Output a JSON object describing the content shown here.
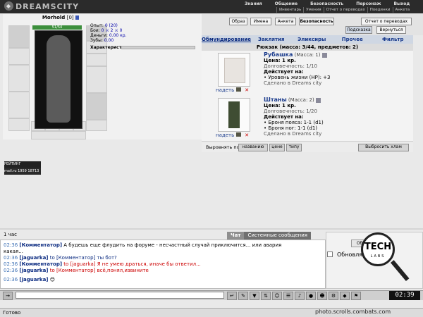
{
  "header": {
    "logo_text": "DREAMSCITY",
    "menu": [
      "Знания",
      "Общение",
      "Безопасность",
      "Персонаж",
      "Выход"
    ],
    "submenu": [
      "Инвентарь",
      "Умения",
      "Отчет о переводах",
      "Поединки",
      "Анкета"
    ]
  },
  "character": {
    "name": "Morhold",
    "level": "[0]",
    "hp": "51/54",
    "stats": [
      {
        "label": "Опыт:",
        "value": "0 (20)"
      },
      {
        "label": "Бои:",
        "value": "0 ⚔ 2 ⚔ 0"
      },
      {
        "label": "Деньги:",
        "value": "0.00 кр."
      },
      {
        "label": "Зубы:",
        "value": "0.00"
      }
    ],
    "traits_label": "Характеристики:"
  },
  "top_buttons": {
    "obraz": "Образ",
    "imena": "Имена",
    "anketa": "Анкета",
    "security": "Безопасность",
    "report": "Отчет о переводах",
    "hint": "Подсказка",
    "back": "Вернуться"
  },
  "tabs": [
    "Обмундирование",
    "Заклятия",
    "Эликсиры",
    "Прочее",
    "Фильтр"
  ],
  "backpack_label": "Рюкзак (масса: 3/44, предметов: 2)",
  "items": [
    {
      "name": "Рубашка",
      "mass": "(Масса: 1)",
      "price": "Цена: 1 кр.",
      "durability": "Долговечность: 1/10",
      "effects_label": "Действует на:",
      "effects": [
        "• Уровень жизни (HP): +3"
      ],
      "made": "Сделано в Dreams city",
      "action": "надеть"
    },
    {
      "name": "Штаны",
      "mass": "(Масса: 2)",
      "price": "Цена: 1 кр.",
      "durability": "Долговечность: 1/20",
      "effects_label": "Действует на:",
      "effects": [
        "• Броня пояса: 1-1 (d1)",
        "• Броня ног: 1-1 (d1)"
      ],
      "made": "Сделано в Dreams city",
      "action": "надеть"
    }
  ],
  "sort": {
    "label": "Выровнять по",
    "by_name": "названию",
    "by_price": "цене",
    "by_type": "типу",
    "throw": "Выбросить хлам"
  },
  "online": {
    "badge1": "РЕЙТИНГ 634119296",
    "badge2": "mail.ru 1959 18713"
  },
  "chat": {
    "time_label": "1 час",
    "tab_chat": "Чат",
    "tab_system": "Системные сообщения",
    "lines": [
      {
        "time": "02:36",
        "name": "[Комментатор]",
        "text": " А будешь еще флудить на форуме - несчастный случай приключится... или авария"
      },
      {
        "time": "",
        "name": "",
        "text": "какая..."
      },
      {
        "time": "02:36",
        "name": "[jaguarka]",
        "text": " to [Комментатор] ты бот?"
      },
      {
        "time": "02:36",
        "name": "[Комментатор]",
        "text": " to [jaguarka] Я не умею драться, иначе бы ответил..."
      },
      {
        "time": "02:36",
        "name": "[jaguarka]",
        "text": " to [Комментатор] всё,понял,извините"
      },
      {
        "time": "02:36",
        "name": "[jaguarka]",
        "text": " 😊"
      }
    ],
    "refresh_label": "Обновлять",
    "refresh_btn": "Обн"
  },
  "toolbar": {
    "clock": "02:39"
  },
  "status": {
    "text": "Готово",
    "url": "photo.scrolls.combats.com"
  },
  "seal": {
    "big": "TECH",
    "small": "LABS"
  }
}
